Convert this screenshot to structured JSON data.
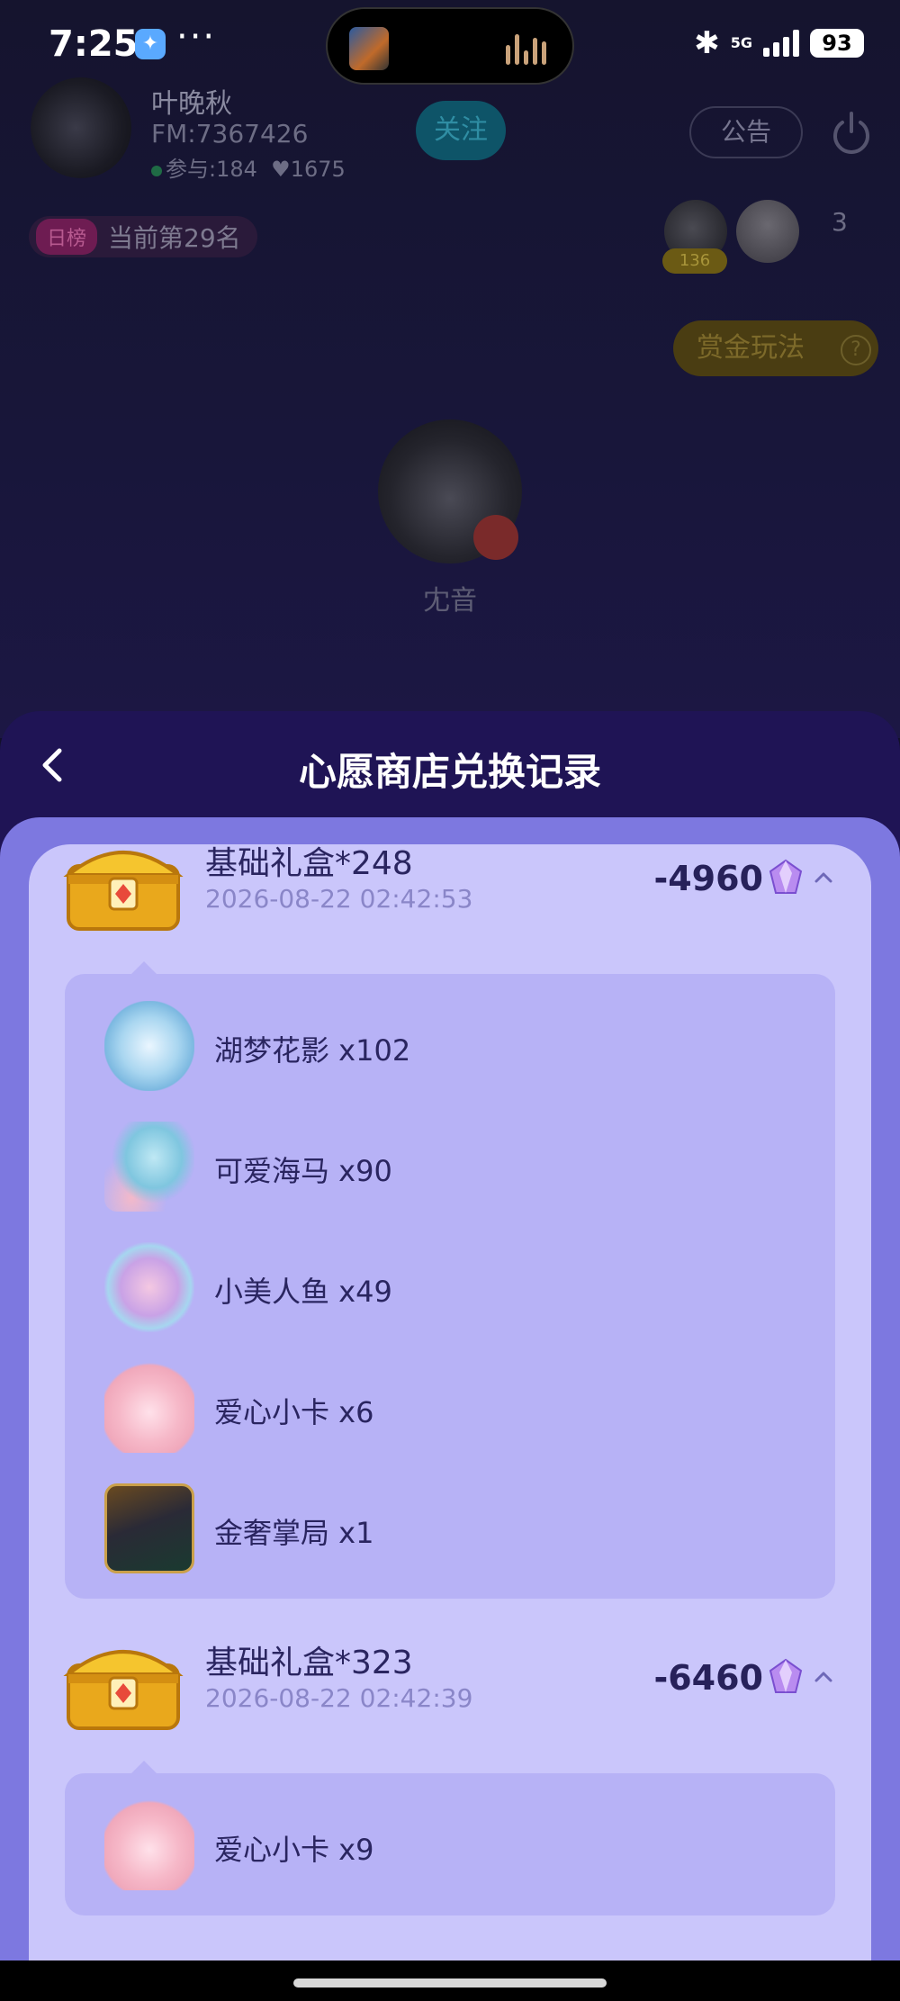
{
  "status_bar": {
    "time": "7:25",
    "app_icon": "bubble-app-icon",
    "dots": "···",
    "network": "5G",
    "battery": "93"
  },
  "room": {
    "host": {
      "name": "叶晚秋",
      "fm": "FM:7367426",
      "participants": "参与:184",
      "likes": "1675"
    },
    "follow_label": "关注",
    "notice_label": "公告",
    "rank_tag": "日榜",
    "rank_text": "当前第29名",
    "audience_badge": "136",
    "audience_count": "3",
    "bounty_label": "赏金玩法",
    "bounty_help": "?",
    "mic_name": "冘音"
  },
  "sheet": {
    "title": "心愿商店兑换记录"
  },
  "records": [
    {
      "title": "基础礼盒*248",
      "time": "2026-08-22 02:42:53",
      "amount": "-4960",
      "items": [
        {
          "name": "湖梦花影 x102",
          "icon": "flower-orb-icon"
        },
        {
          "name": "可爱海马 x90",
          "icon": "seahorse-icon"
        },
        {
          "name": "小美人鱼 x49",
          "icon": "mermaid-icon"
        },
        {
          "name": "爱心小卡 x6",
          "icon": "heart-card-icon"
        },
        {
          "name": "金奢掌局 x1",
          "icon": "gentleman-icon"
        }
      ]
    },
    {
      "title": "基础礼盒*323",
      "time": "2026-08-22 02:42:39",
      "amount": "-6460",
      "items": [
        {
          "name": "爱心小卡 x9",
          "icon": "heart-card-icon"
        }
      ]
    }
  ],
  "colors": {
    "sheet_bg": "#1f1455",
    "panel_bg": "#7d78e0",
    "list_bg": "#cac6fb",
    "items_bg": "#b7b2f6",
    "text_dark": "#2a2560",
    "text_time": "#8a86c8"
  }
}
